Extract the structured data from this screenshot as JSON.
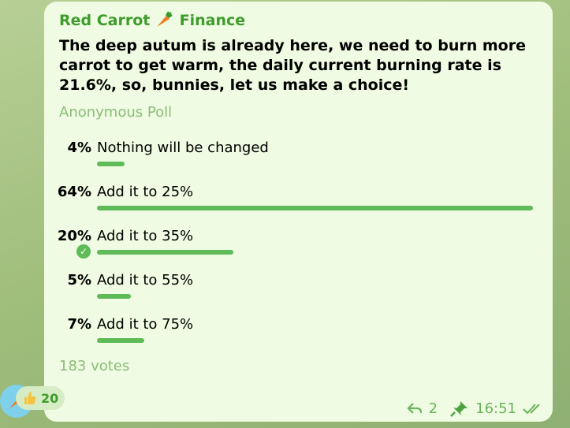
{
  "message": {
    "sender": "Red Carrot",
    "sender_suffix": "Finance",
    "question": "The deep autum is already here, we need to burn more carrot to get warm, the daily current burning rate is 21.6%, so, bunnies, let us make a choice!",
    "poll_type": "Anonymous Poll",
    "options": [
      {
        "percent_label": "4%",
        "text": "Nothing will be changed",
        "percent": 4,
        "chosen": false
      },
      {
        "percent_label": "64%",
        "text": "Add it to  25%",
        "percent": 64,
        "chosen": false
      },
      {
        "percent_label": "20%",
        "text": "Add it to 35%",
        "percent": 20,
        "chosen": true
      },
      {
        "percent_label": "5%",
        "text": "Add it to 55%",
        "percent": 5,
        "chosen": false
      },
      {
        "percent_label": "7%",
        "text": "Add it to 75%",
        "percent": 7,
        "chosen": false
      }
    ],
    "votes_label": "183 votes",
    "reaction_count": "20",
    "forwards": "2",
    "time": "16:51",
    "colors": {
      "accent": "#5fbb58",
      "sender": "#3e9c2c",
      "bubble": "#effbe2"
    },
    "icons": [
      "carrot-icon",
      "checkmark-icon",
      "thumbs-up-icon",
      "forward-icon",
      "pin-icon",
      "double-check-icon"
    ]
  }
}
